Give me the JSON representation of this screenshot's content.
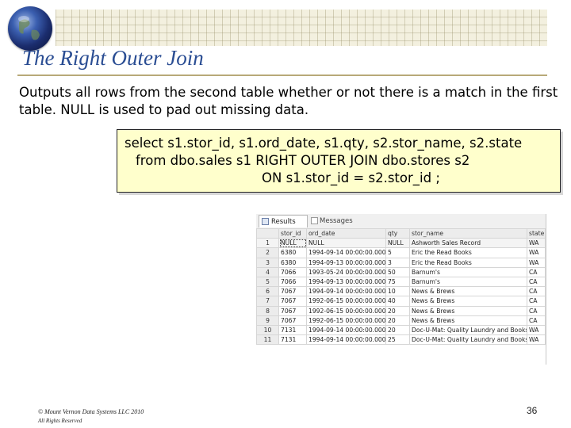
{
  "slide": {
    "title": "The Right Outer Join",
    "intro": "Outputs all rows from the second table whether or not there is a match in the first table. NULL is used to pad out missing data.",
    "code_lines": [
      "select s1.stor_id, s1.ord_date, s1.qty, s2.stor_name, s2.state",
      "from dbo.sales s1 RIGHT OUTER JOIN dbo.stores s2",
      "ON s1.stor_id = s2.stor_id ;"
    ],
    "footer": {
      "copyright": "© Mount Vernon Data Systems LLC 2010",
      "rights": "All Rights Reserved",
      "slide_number": "36"
    },
    "colors": {
      "title": "#2a4d93",
      "code_background": "#ffffcc",
      "header_band": "#f3f0df"
    }
  },
  "results": {
    "tabs": [
      {
        "label": "Results",
        "icon": "grid-icon",
        "active": true
      },
      {
        "label": "Messages",
        "icon": "message-icon",
        "active": false
      }
    ],
    "columns": [
      "",
      "stor_id",
      "ord_date",
      "qty",
      "stor_name",
      "state"
    ],
    "rows": [
      [
        "1",
        "NULL",
        "NULL",
        "NULL",
        "Ashworth Sales Record",
        "WA"
      ],
      [
        "2",
        "6380",
        "1994-09-14 00:00:00.000",
        "5",
        "Eric the Read Books",
        "WA"
      ],
      [
        "3",
        "6380",
        "1994-09-13 00:00:00.000",
        "3",
        "Eric the Read Books",
        "WA"
      ],
      [
        "4",
        "7066",
        "1993-05-24 00:00:00.000",
        "50",
        "Barnum's",
        "CA"
      ],
      [
        "5",
        "7066",
        "1994-09-13 00:00:00.000",
        "75",
        "Barnum's",
        "CA"
      ],
      [
        "6",
        "7067",
        "1994-09-14 00:00:00.000",
        "10",
        "News & Brews",
        "CA"
      ],
      [
        "7",
        "7067",
        "1992-06-15 00:00:00.000",
        "40",
        "News & Brews",
        "CA"
      ],
      [
        "8",
        "7067",
        "1992-06-15 00:00:00.000",
        "20",
        "News & Brews",
        "CA"
      ],
      [
        "9",
        "7067",
        "1992-06-15 00:00:00.000",
        "20",
        "News & Brews",
        "CA"
      ],
      [
        "10",
        "7131",
        "1994-09-14 00:00:00.000",
        "20",
        "Doc-U-Mat: Quality Laundry and Books",
        "WA"
      ],
      [
        "11",
        "7131",
        "1994-09-14 00:00:00.000",
        "25",
        "Doc-U-Mat: Quality Laundry and Books",
        "WA"
      ]
    ]
  }
}
